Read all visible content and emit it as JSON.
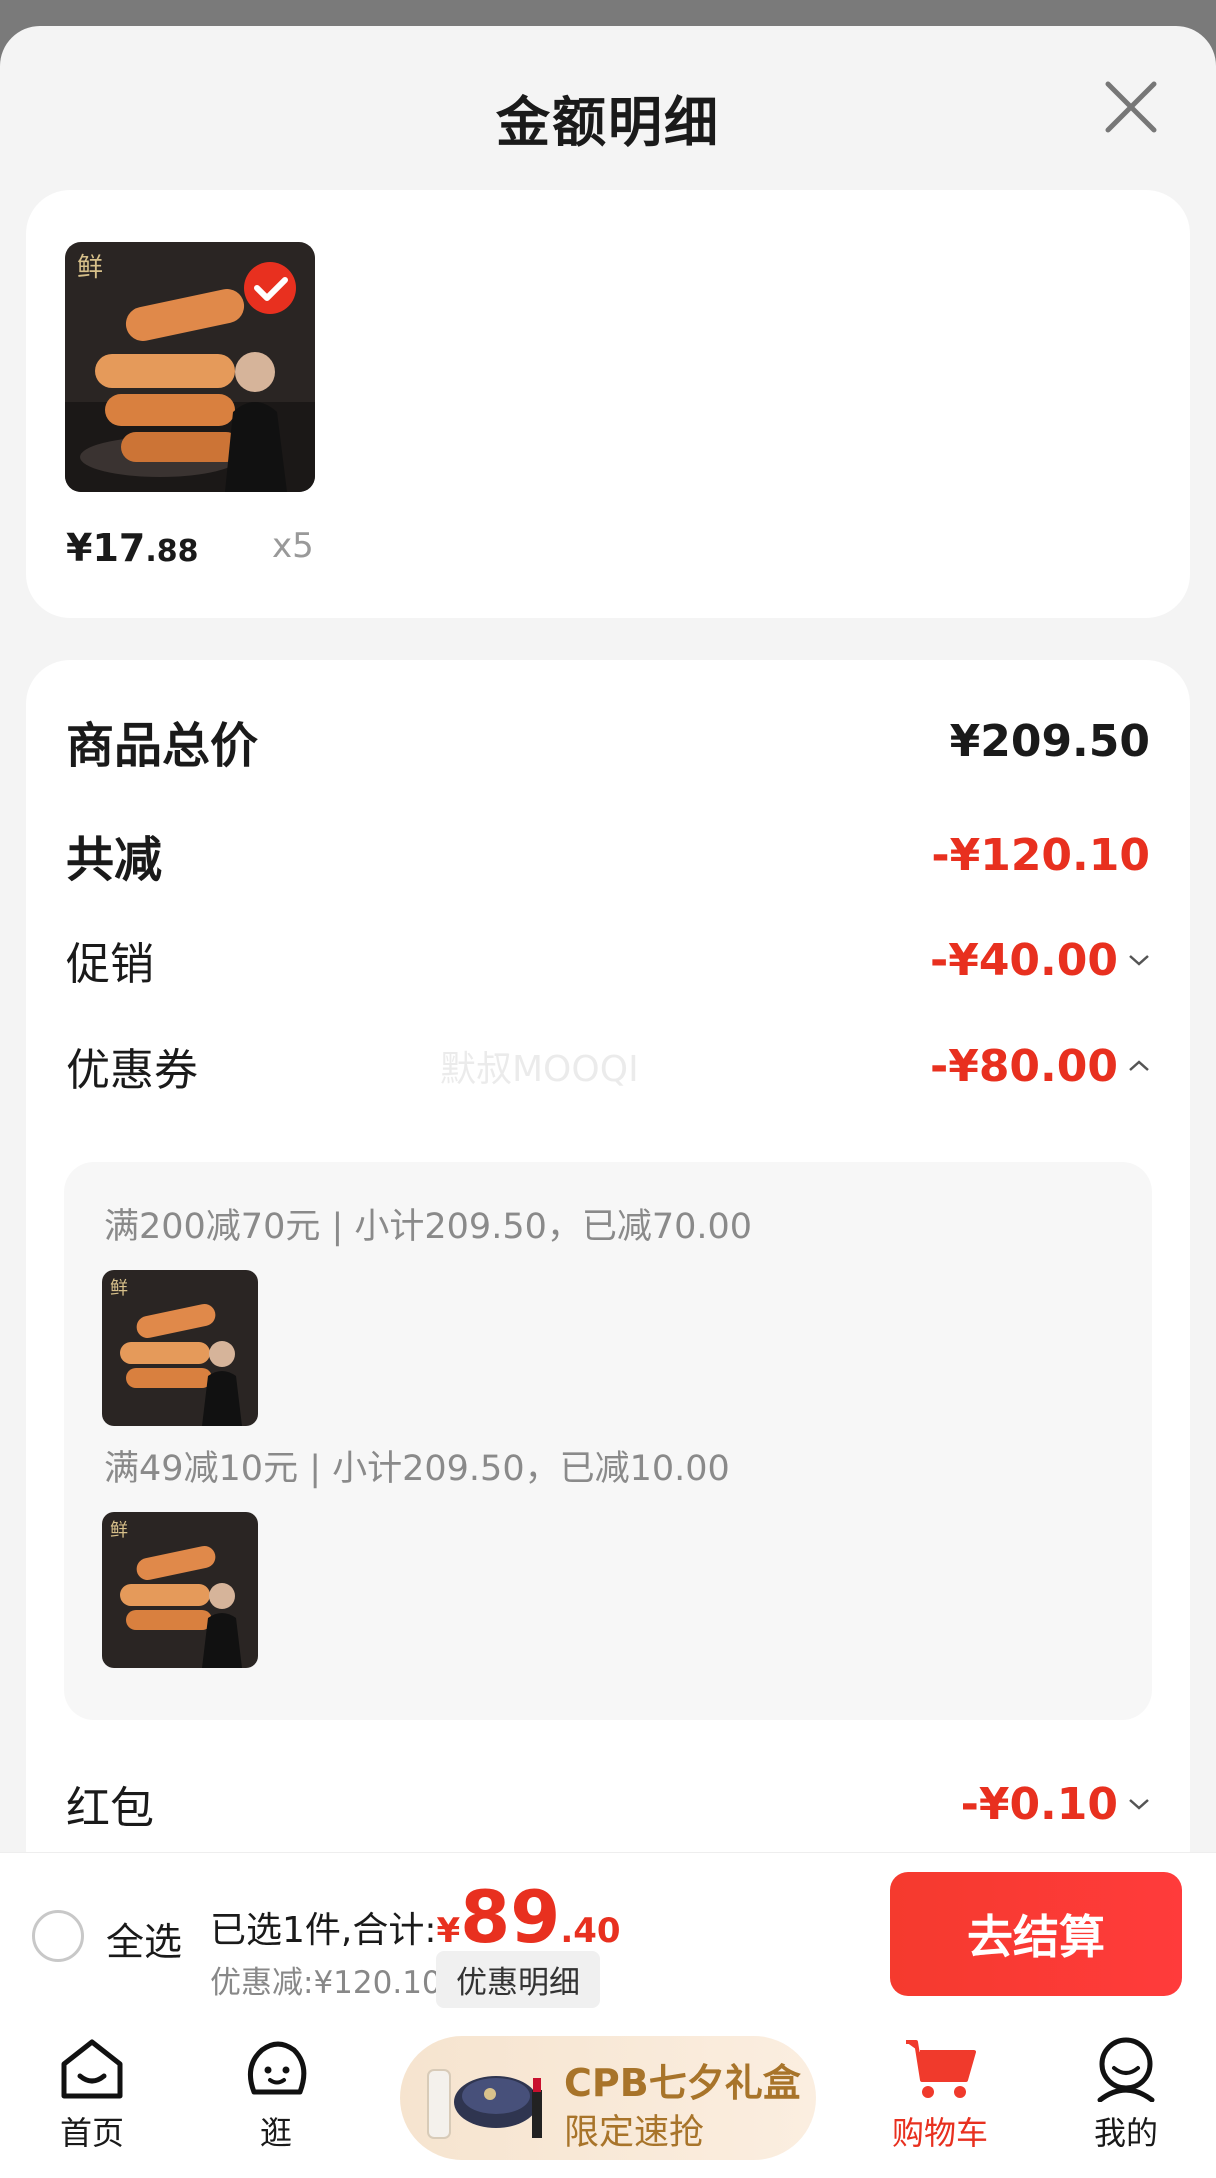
{
  "header": {
    "title": "金额明细"
  },
  "item": {
    "price_int": "¥17",
    "price_dec": ".88",
    "qty": "x5"
  },
  "summary": {
    "total_label": "商品总价",
    "total_value": "¥209.50",
    "reduce_label": "共减",
    "reduce_value": "-¥120.10",
    "promo_label": "促销",
    "promo_value": "-¥40.00",
    "coupon_label": "优惠券",
    "coupon_value": "-¥80.00",
    "redpacket_label": "红包",
    "redpacket_value": "-¥0.10"
  },
  "coupons": [
    {
      "rule": "满200减70元 | 小计209.50，已减70.00"
    },
    {
      "rule": "满49减10元 | 小计209.50，已减10.00"
    }
  ],
  "watermark": "默叔MOOQI",
  "footer": {
    "select_all": "全选",
    "selected_text": "已选1件,合计:",
    "yen": "¥",
    "amount_int": "89",
    "amount_dec": ".40",
    "discount_text": "优惠减:¥120.10",
    "detail_btn": "优惠明细",
    "checkout": "去结算"
  },
  "nav": {
    "home": "首页",
    "browse": "逛",
    "promo_line1": "CPB七夕礼盒",
    "promo_line2": "限定速抢",
    "cart": "购物车",
    "mine": "我的"
  },
  "colors": {
    "accent": "#e8301f",
    "promo_text": "#a8742a"
  }
}
